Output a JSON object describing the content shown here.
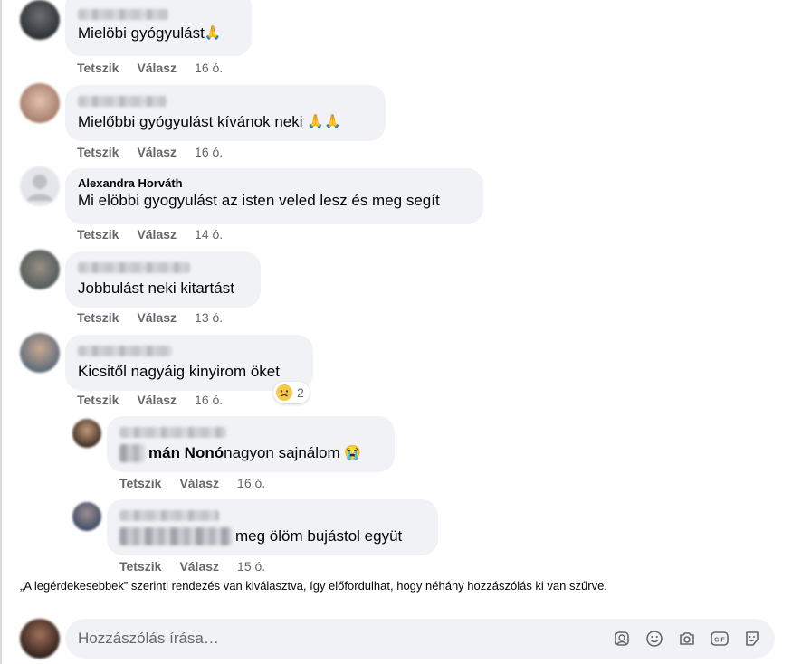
{
  "comments": [
    {
      "author": "",
      "text": "Mielöbi gyógyulást",
      "emoji": "🙏",
      "like": "Tetszik",
      "reply": "Válasz",
      "time": "16 ó."
    },
    {
      "author": "",
      "text": "Mielőbbi gyógyulást kívánok neki",
      "emoji": "🙏🙏",
      "like": "Tetszik",
      "reply": "Válasz",
      "time": "16 ó."
    },
    {
      "author": "Alexandra Horváth",
      "text": "Mi elöbbi gyogyulást az isten veled lesz és meg segít",
      "like": "Tetszik",
      "reply": "Válasz",
      "time": "14 ó."
    },
    {
      "author": "",
      "text": "Jobbulást neki kitartást",
      "like": "Tetszik",
      "reply": "Válasz",
      "time": "13 ó."
    },
    {
      "author": "",
      "text": "Kicsitől nagyáig kinyirom öket",
      "like": "Tetszik",
      "reply": "Válasz",
      "time": "16 ó.",
      "reaction_count": "2"
    }
  ],
  "replies": [
    {
      "mention": "mán Nonó",
      "text": " nagyon sajnálom",
      "emoji": "😭",
      "like": "Tetszik",
      "reply": "Válasz",
      "time": "16 ó."
    },
    {
      "text": "meg ölöm bujástol együt",
      "like": "Tetszik",
      "reply": "Válasz",
      "time": "15 ó."
    }
  ],
  "notice": "„A legérdekesebbek” szerinti rendezés van kiválasztva, így előfordulhat, hogy néhány hozzászólás ki van szűrve.",
  "composer": {
    "placeholder": "Hozzászólás írása…"
  },
  "icons": [
    "sticker-avatar-icon",
    "emoji-icon",
    "camera-icon",
    "gif-icon",
    "sticker-icon"
  ]
}
